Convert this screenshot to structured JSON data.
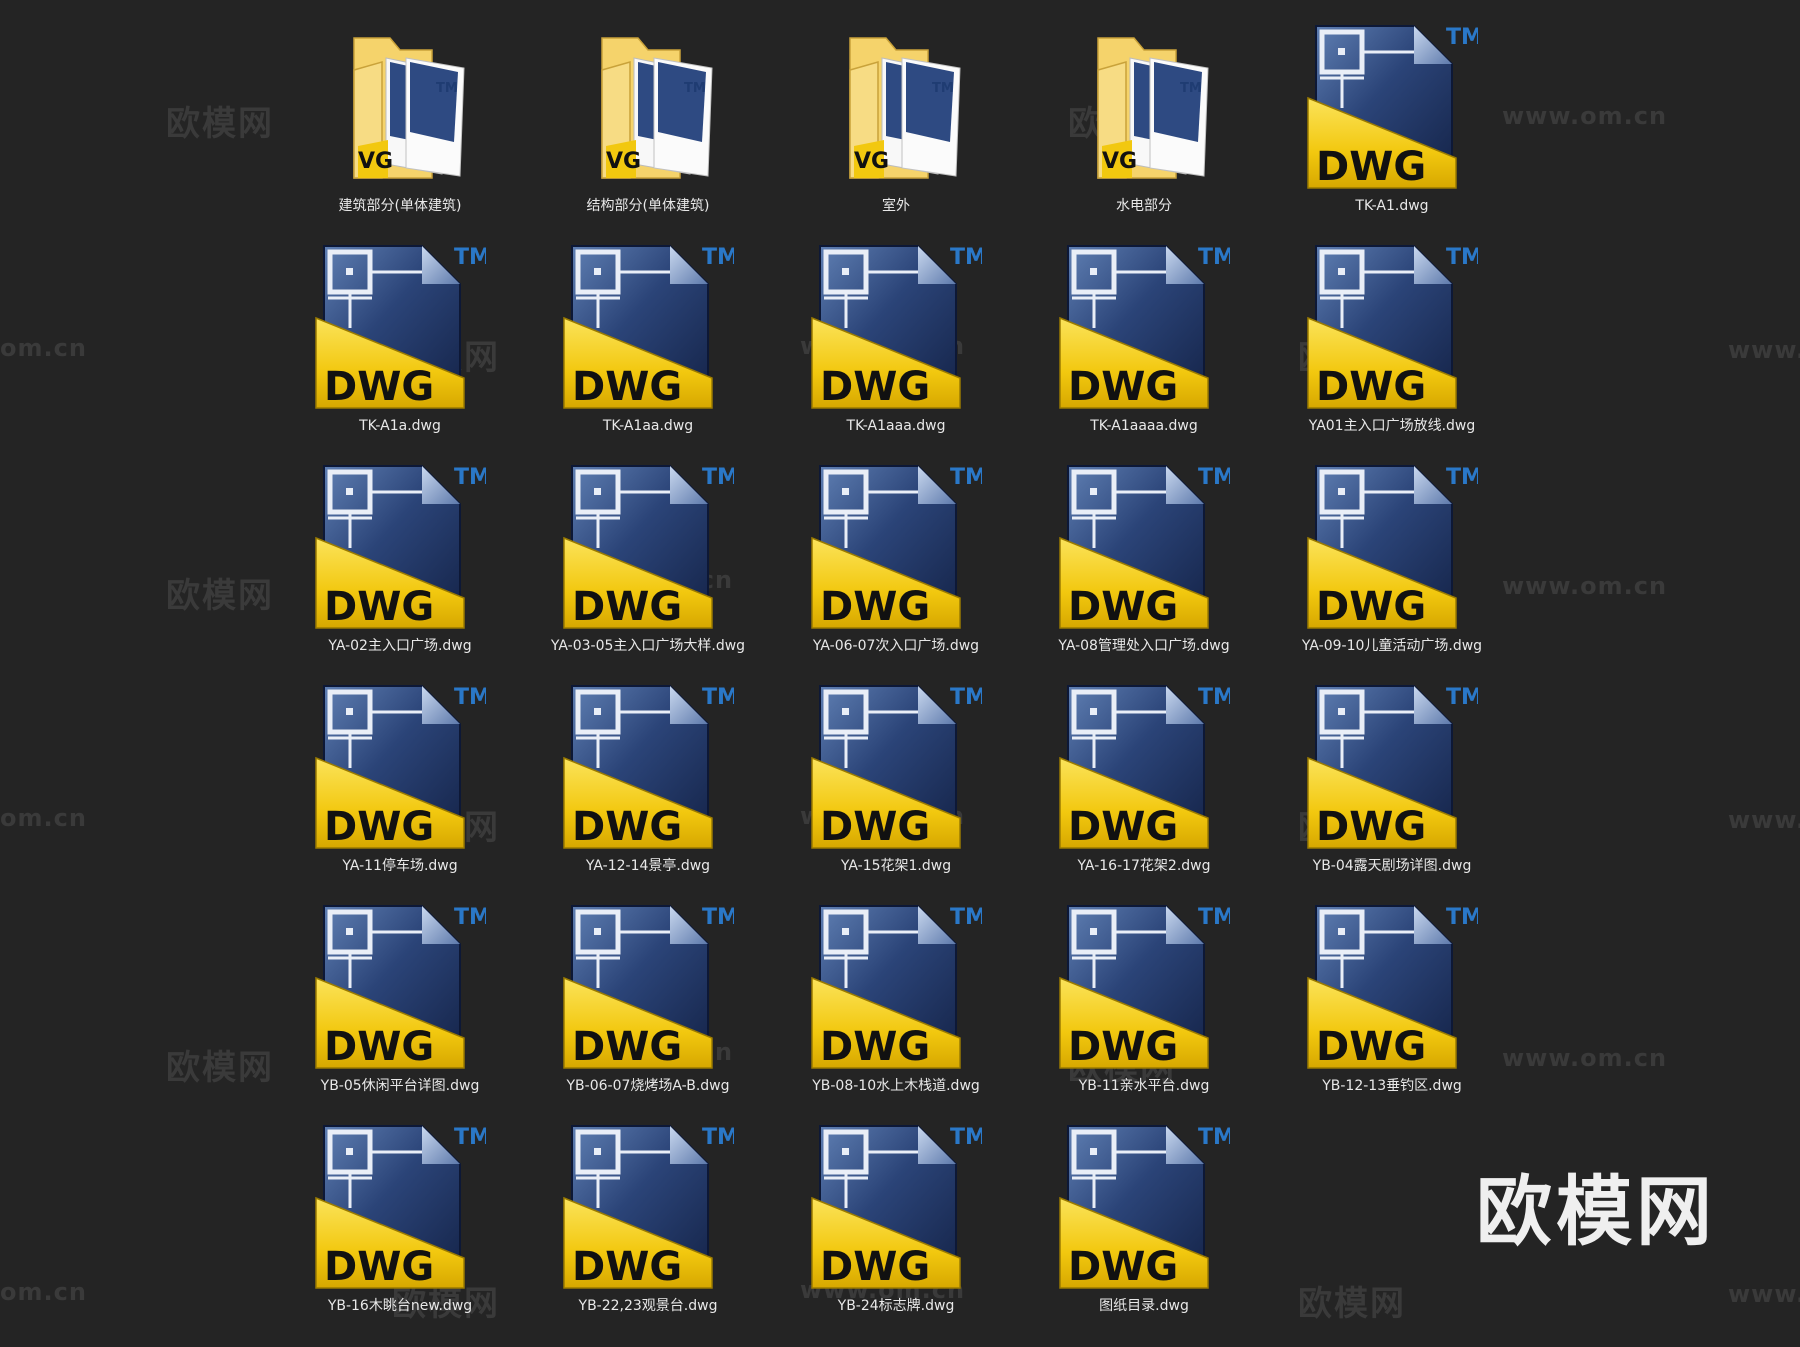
{
  "watermarks": {
    "chinese": "欧模网",
    "site": "www.om.cn",
    "site_short": "om.cn",
    "site_prefix": "www."
  },
  "brand_mark": "欧模网",
  "icons": {
    "folder": "folder-icon",
    "dwg": "dwg-file-icon",
    "dwg_badge_text": "DWG",
    "tm_text": "TM"
  },
  "colors": {
    "background": "#242424",
    "label_text": "#e8e8e8",
    "dwg_yellow": "#f2c80f",
    "dwg_navy": "#1e3160",
    "tm_blue": "#2a78c8",
    "folder_tan": "#f6d67c"
  },
  "items": [
    {
      "type": "folder",
      "label": "建筑部分(单体建筑)"
    },
    {
      "type": "folder",
      "label": "结构部分(单体建筑)"
    },
    {
      "type": "folder",
      "label": "室外"
    },
    {
      "type": "folder",
      "label": "水电部分"
    },
    {
      "type": "dwg",
      "label": "TK-A1.dwg"
    },
    {
      "type": "dwg",
      "label": "TK-A1a.dwg"
    },
    {
      "type": "dwg",
      "label": "TK-A1aa.dwg"
    },
    {
      "type": "dwg",
      "label": "TK-A1aaa.dwg"
    },
    {
      "type": "dwg",
      "label": "TK-A1aaaa.dwg"
    },
    {
      "type": "dwg",
      "label": "YA01主入口广场放线.dwg"
    },
    {
      "type": "dwg",
      "label": "YA-02主入口广场.dwg"
    },
    {
      "type": "dwg",
      "label": "YA-03-05主入口广场大样.dwg"
    },
    {
      "type": "dwg",
      "label": "YA-06-07次入口广场.dwg"
    },
    {
      "type": "dwg",
      "label": "YA-08管理处入口广场.dwg"
    },
    {
      "type": "dwg",
      "label": "YA-09-10儿童活动广场.dwg"
    },
    {
      "type": "dwg",
      "label": "YA-11停车场.dwg"
    },
    {
      "type": "dwg",
      "label": "YA-12-14景亭.dwg"
    },
    {
      "type": "dwg",
      "label": "YA-15花架1.dwg"
    },
    {
      "type": "dwg",
      "label": "YA-16-17花架2.dwg"
    },
    {
      "type": "dwg",
      "label": "YB-04露天剧场详图.dwg"
    },
    {
      "type": "dwg",
      "label": "YB-05休闲平台详图.dwg"
    },
    {
      "type": "dwg",
      "label": "YB-06-07烧烤场A-B.dwg"
    },
    {
      "type": "dwg",
      "label": "YB-08-10水上木栈道.dwg"
    },
    {
      "type": "dwg",
      "label": "YB-11亲水平台.dwg"
    },
    {
      "type": "dwg",
      "label": "YB-12-13垂钓区.dwg"
    },
    {
      "type": "dwg",
      "label": "YB-16木眺台new.dwg"
    },
    {
      "type": "dwg",
      "label": "YB-22,23观景台.dwg"
    },
    {
      "type": "dwg",
      "label": "YB-24标志牌.dwg"
    },
    {
      "type": "dwg",
      "label": "图纸目录.dwg"
    }
  ]
}
